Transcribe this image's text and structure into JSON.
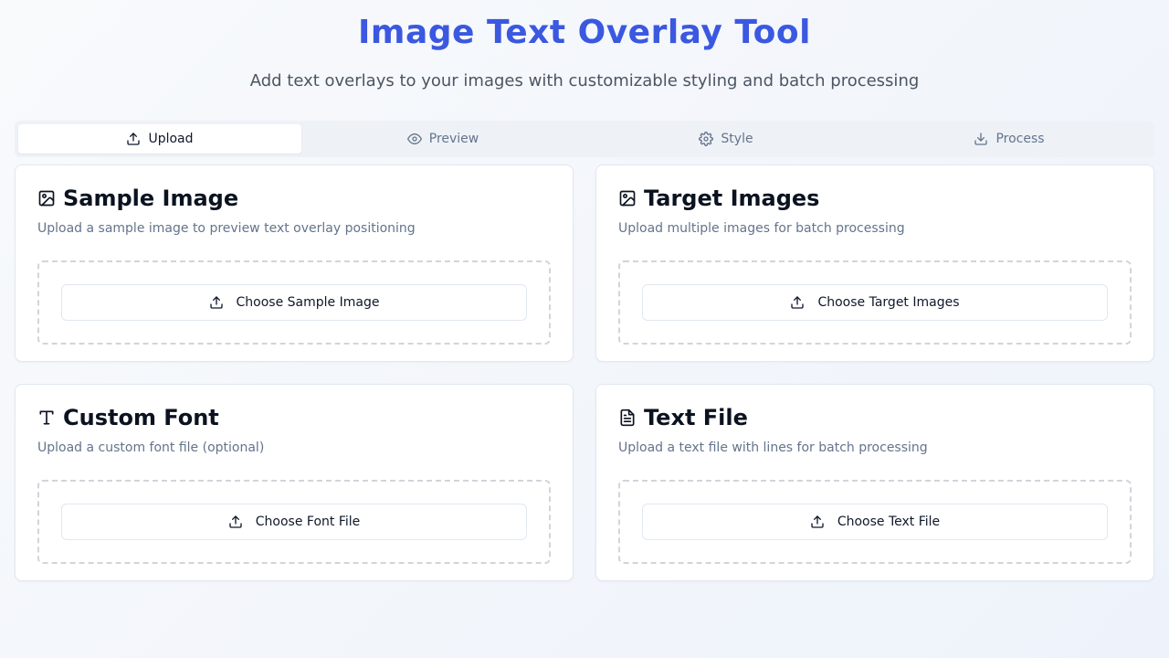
{
  "header": {
    "title": "Image Text Overlay Tool",
    "subtitle": "Add text overlays to your images with customizable styling and batch processing"
  },
  "tabs": [
    {
      "label": "Upload",
      "icon": "upload-icon",
      "active": true
    },
    {
      "label": "Preview",
      "icon": "eye-icon",
      "active": false
    },
    {
      "label": "Style",
      "icon": "gear-icon",
      "active": false
    },
    {
      "label": "Process",
      "icon": "download-icon",
      "active": false
    }
  ],
  "cards": {
    "sample_image": {
      "title": "Sample Image",
      "icon": "image-icon",
      "description": "Upload a sample image to preview text overlay positioning",
      "button": "Choose Sample Image"
    },
    "target_images": {
      "title": "Target Images",
      "icon": "image-icon",
      "description": "Upload multiple images for batch processing",
      "button": "Choose Target Images"
    },
    "custom_font": {
      "title": "Custom Font",
      "icon": "type-icon",
      "description": "Upload a custom font file (optional)",
      "button": "Choose Font File"
    },
    "text_file": {
      "title": "Text File",
      "icon": "file-text-icon",
      "description": "Upload a text file with lines for batch processing",
      "button": "Choose Text File"
    }
  },
  "colors": {
    "accent": "#3b58e0",
    "muted_text": "#64748b",
    "border": "#e2e8f0"
  }
}
